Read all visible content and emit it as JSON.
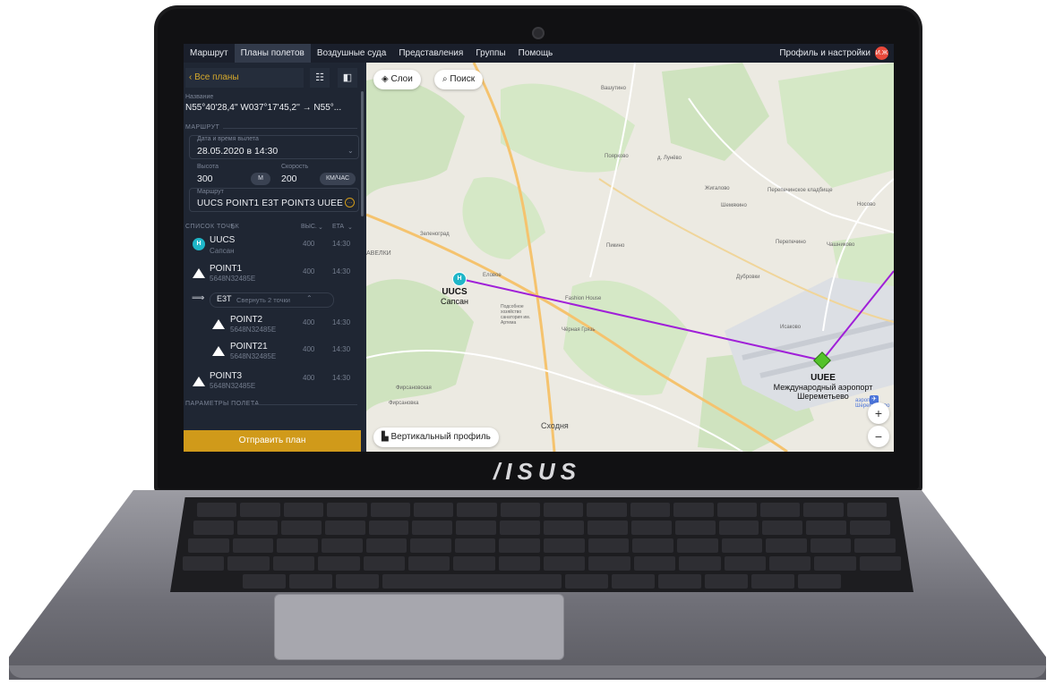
{
  "brand": "/ISUS",
  "nav": {
    "items": [
      "Маршрут",
      "Планы полетов",
      "Воздушные суда",
      "Представления",
      "Группы",
      "Помощь"
    ],
    "active_index": 1,
    "profile_label": "Профиль и настройки",
    "avatar_initials": "И.Ж"
  },
  "sidebar": {
    "back_label": "‹ Все планы",
    "list_icon": "☷",
    "panel_icon": "◧",
    "name_label": "Название",
    "name_value": "N55°40'28,4'' W037°17'45,2'' → N55°...",
    "section_route": "МАРШРУТ",
    "datetime_label": "Дата и время вылета",
    "datetime_value": "28.05.2020 в 14:30",
    "altitude_label": "Высота",
    "altitude_value": "300",
    "altitude_unit": "М",
    "speed_label": "Скорость",
    "speed_value": "200",
    "speed_unit": "КМ/ЧАС",
    "route_label": "Маршрут",
    "route_value": "UUCS POINT1 E3T POINT3 UUEE",
    "points_label": "СПИСОК ТОЧЕК",
    "col_alt": "ВЫС.",
    "col_eta": "ETA",
    "points": [
      {
        "name": "UUCS",
        "sub": "Сапсан",
        "alt": "400",
        "eta": "14:30"
      },
      {
        "name": "POINT1",
        "sub": "5648N32485E",
        "alt": "400",
        "eta": "14:30"
      },
      {
        "name": "POINT2",
        "sub": "5648N32485E",
        "alt": "400",
        "eta": "14:30"
      },
      {
        "name": "POINT21",
        "sub": "5648N32485E",
        "alt": "400",
        "eta": "14:30"
      },
      {
        "name": "POINT3",
        "sub": "5648N32485E",
        "alt": "400",
        "eta": "14:30"
      }
    ],
    "group_name": "E3T",
    "group_collapse": "Свернуть 2 точки",
    "section_params": "ПАРАМЕТРЫ ПОЛЕТА",
    "send_label": "Отправить план"
  },
  "map": {
    "layers_label": "Слои",
    "search_label": "Поиск",
    "profile_label": "Вертикальный профиль",
    "zoom_in": "+",
    "zoom_out": "−",
    "origin_code": "UUCS",
    "origin_name": "Сапсан",
    "dest_code": "UUEE",
    "dest_name": "Международный аэропорт",
    "dest_name2": "Шереметьево",
    "route_color": "#a020d8",
    "places": [
      "Вашутино",
      "Поярково",
      "д. Лунёво",
      "Жигалово",
      "Перепечинское кладбище",
      "Шемякино",
      "Носово",
      "Перепечино",
      "Чашниково",
      "Дубровки",
      "Пикино",
      "Еловое",
      "Зеленоград",
      "Fashion House",
      "Подсобное хозяйство санатория им. Артема",
      "Чёрная Грязь",
      "Фирсановская",
      "Фирсановка",
      "Сходня",
      "АВЕЛКИ",
      "Исаково",
      "аэропорт Шереметьево"
    ]
  }
}
